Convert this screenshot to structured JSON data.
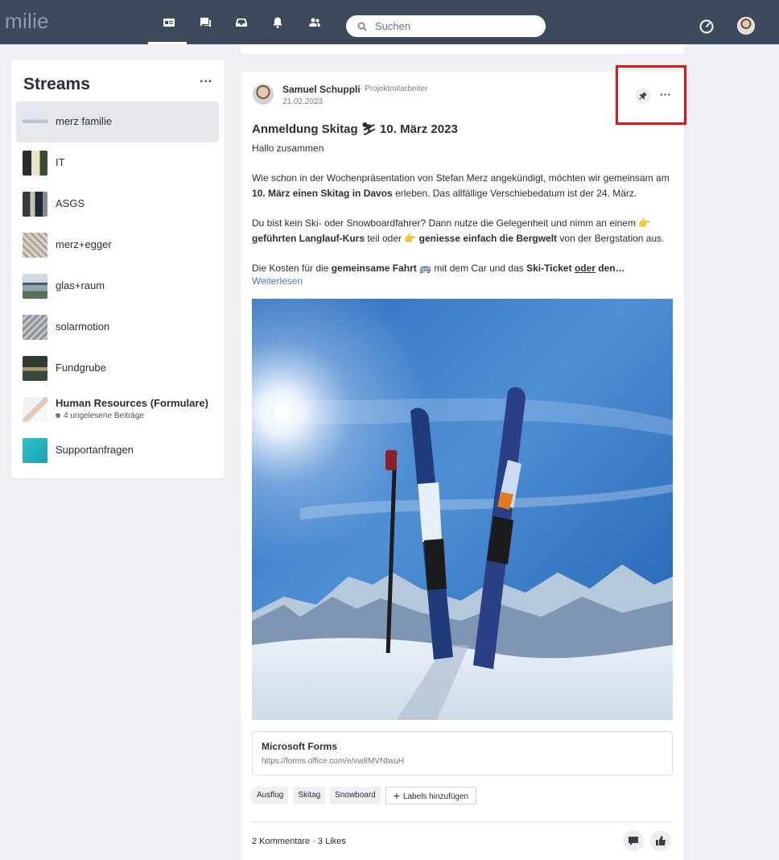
{
  "topbar": {
    "brand": "milie",
    "search_placeholder": "Suchen",
    "nav_icons": [
      "feed-icon",
      "chat-icon",
      "inbox-icon",
      "bell-icon",
      "people-icon"
    ]
  },
  "sidebar": {
    "title": "Streams",
    "more": "···",
    "items": [
      {
        "label": "merz familie"
      },
      {
        "label": "IT"
      },
      {
        "label": "ASGS"
      },
      {
        "label": "merz+egger"
      },
      {
        "label": "glas+raum"
      },
      {
        "label": "solarmotion"
      },
      {
        "label": "Fundgrube"
      },
      {
        "label": "Human Resources (Formulare)",
        "sub": "4 ungelesene Beiträge"
      },
      {
        "label": "Supportanfragen"
      }
    ]
  },
  "post": {
    "author": "Samuel Schuppli",
    "role": "· Projektmitarbeiter",
    "date": "21.02.2023",
    "more": "···",
    "title_pre": "Anmeldung Skitag ",
    "title_emoji": "⛷",
    "title_post": " 10. März 2023",
    "greeting": "Hallo zusammen",
    "p1_a": "Wie schon in der Wochenpräsentation von Stefan Merz angekündigt, möchten wir gemeinsam am ",
    "p1_b": "10. März einen Skitag in Davos",
    "p1_c": " erleben. Das allfällige Verschiebedatum ist der 24. März.",
    "p2_a": "Du bist kein Ski- oder Snowboardfahrer? Dann nutze die Gelegenheit und nimm an einem ",
    "p2_emoji": "👉",
    "p2_b": "geführten Langlauf-Kurs",
    "p2_c": " teil oder ",
    "p2_d": "geniesse einfach die Bergwelt",
    "p2_e": " von der Bergstation aus.",
    "p3_a": "Die Kosten für die ",
    "p3_b": "gemeinsame Fahrt",
    "p3_emoji": "🚌",
    "p3_c": " mit dem Car und das ",
    "p3_d": "Ski-Ticket",
    "p3_e": "oder",
    "p3_f": " den…",
    "read_more": "Weiterlesen",
    "link_title": "Microsoft Forms",
    "link_url": "https://forms.office.com/e/vw8MVNtwuH",
    "tags": [
      "Ausflug",
      "Skitag",
      "Snowboard"
    ],
    "add_label": "Labels hinzufügen",
    "meta": "2 Kommentare · 3 Likes"
  },
  "colors": {
    "topbar": "#3c4a5c",
    "accent_link": "#4a7ab8",
    "highlight": "#e0151d"
  }
}
